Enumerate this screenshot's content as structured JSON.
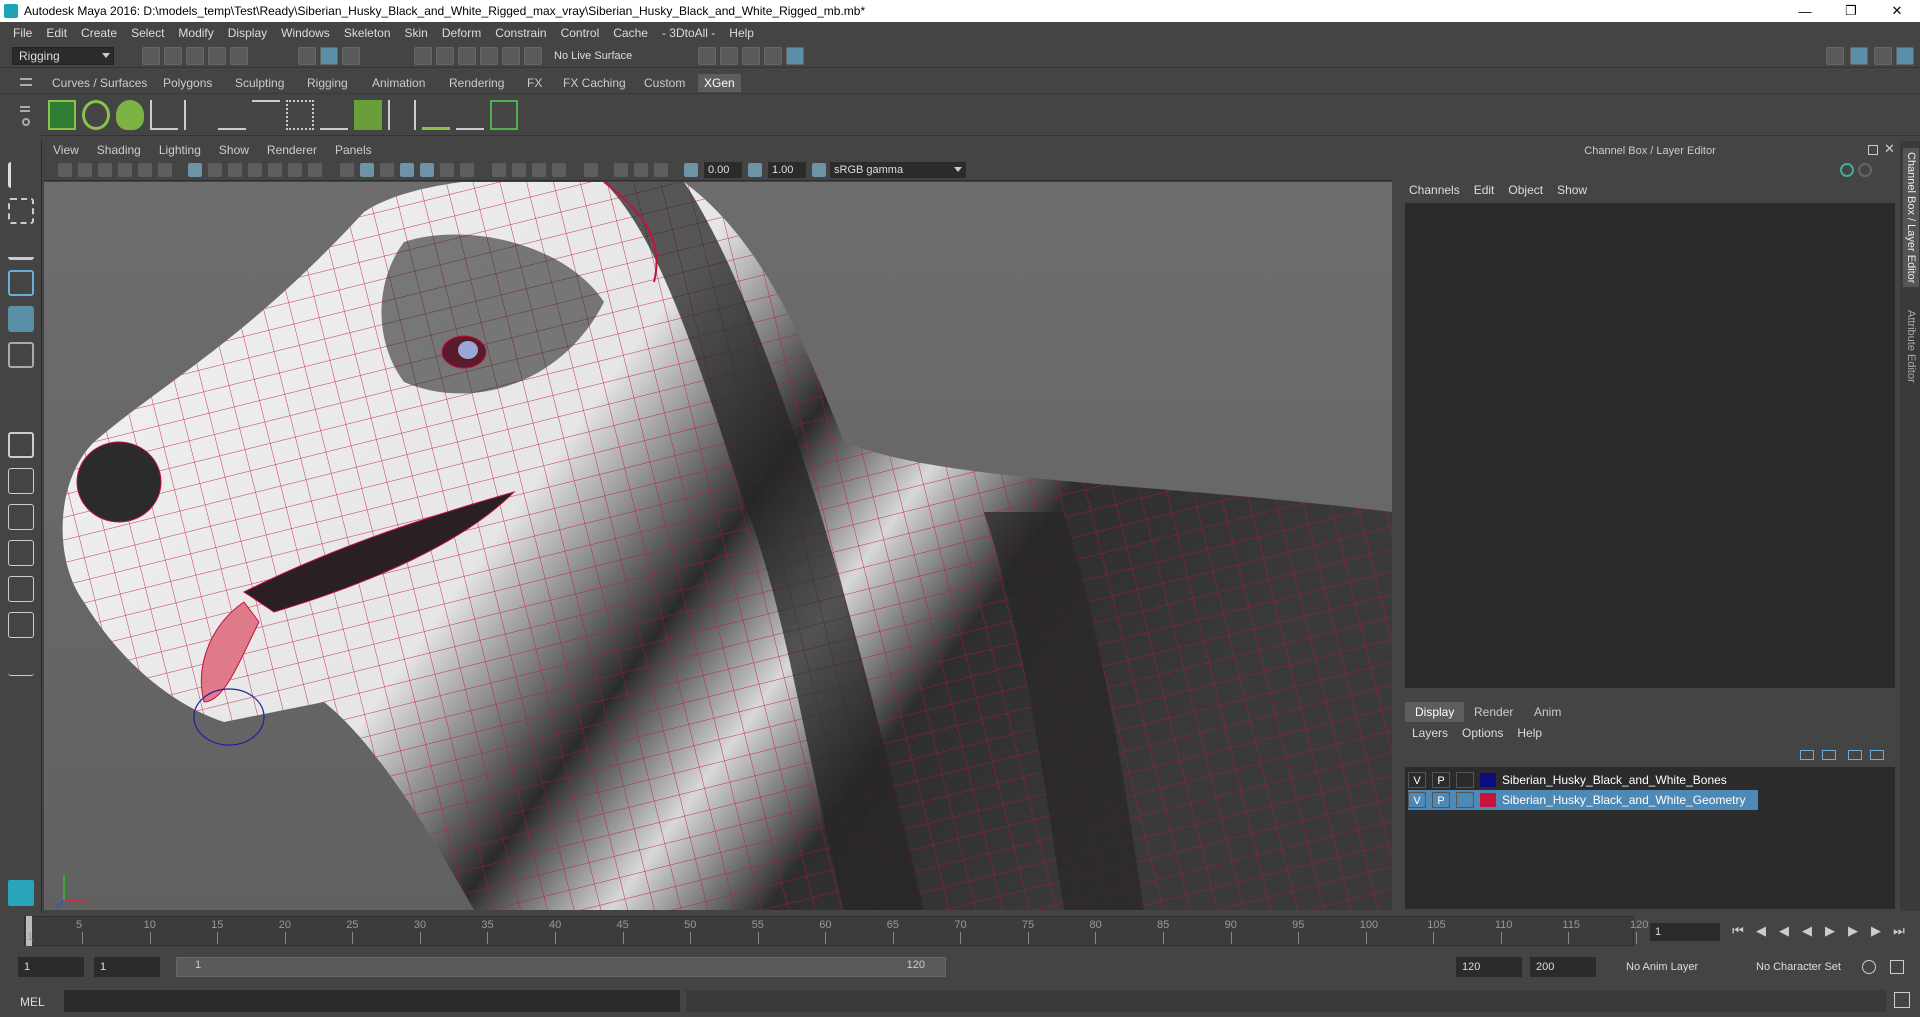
{
  "window": {
    "title": "Autodesk Maya 2016: D:\\models_temp\\Test\\Ready\\Siberian_Husky_Black_and_White_Rigged_max_vray\\Siberian_Husky_Black_and_White_Rigged_mb.mb*"
  },
  "menubar": [
    "File",
    "Edit",
    "Create",
    "Select",
    "Modify",
    "Display",
    "Windows",
    "Skeleton",
    "Skin",
    "Deform",
    "Constrain",
    "Control",
    "Cache",
    "- 3DtoAll -",
    "Help"
  ],
  "statusline": {
    "mode": "Rigging",
    "live_surface": "No Live Surface"
  },
  "shelf_tabs": [
    "Curves / Surfaces",
    "Polygons",
    "Sculpting",
    "Rigging",
    "Animation",
    "Rendering",
    "FX",
    "FX Caching",
    "Custom",
    "XGen"
  ],
  "shelf_active": "XGen",
  "viewport": {
    "menu": [
      "View",
      "Shading",
      "Lighting",
      "Show",
      "Renderer",
      "Panels"
    ],
    "exposure": "0.00",
    "gamma": "1.00",
    "color_space": "sRGB gamma"
  },
  "channel_box": {
    "header": "Channel Box / Layer Editor",
    "menu": [
      "Channels",
      "Edit",
      "Object",
      "Show"
    ]
  },
  "layer_editor": {
    "tabs": [
      "Display",
      "Render",
      "Anim"
    ],
    "active_tab": "Display",
    "menu": [
      "Layers",
      "Options",
      "Help"
    ],
    "layers": [
      {
        "v": "V",
        "p": "P",
        "name": "Siberian_Husky_Black_and_White_Bones",
        "color": "#0c0c7a",
        "selected": false
      },
      {
        "v": "V",
        "p": "P",
        "name": "Siberian_Husky_Black_and_White_Geometry",
        "color": "#c8143c",
        "selected": true
      }
    ]
  },
  "side_tabs": [
    "Channel Box / Layer Editor",
    "Attribute Editor"
  ],
  "timeslider": {
    "ticks": [
      "5",
      "10",
      "15",
      "20",
      "25",
      "30",
      "35",
      "40",
      "45",
      "50",
      "55",
      "60",
      "65",
      "70",
      "75",
      "80",
      "85",
      "90",
      "95",
      "100",
      "105",
      "110",
      "115",
      "120"
    ],
    "start_label": "1",
    "current_frame": "1"
  },
  "range": {
    "start": "1",
    "playback_start": "1",
    "slider_start": "1",
    "slider_end": "120",
    "playback_end": "120",
    "end": "200",
    "anim_layer": "No Anim Layer",
    "character_set": "No Character Set"
  },
  "cmdline": {
    "label": "MEL"
  },
  "colors": {
    "accent": "#5b8fa8",
    "wire": "#c0143c"
  }
}
